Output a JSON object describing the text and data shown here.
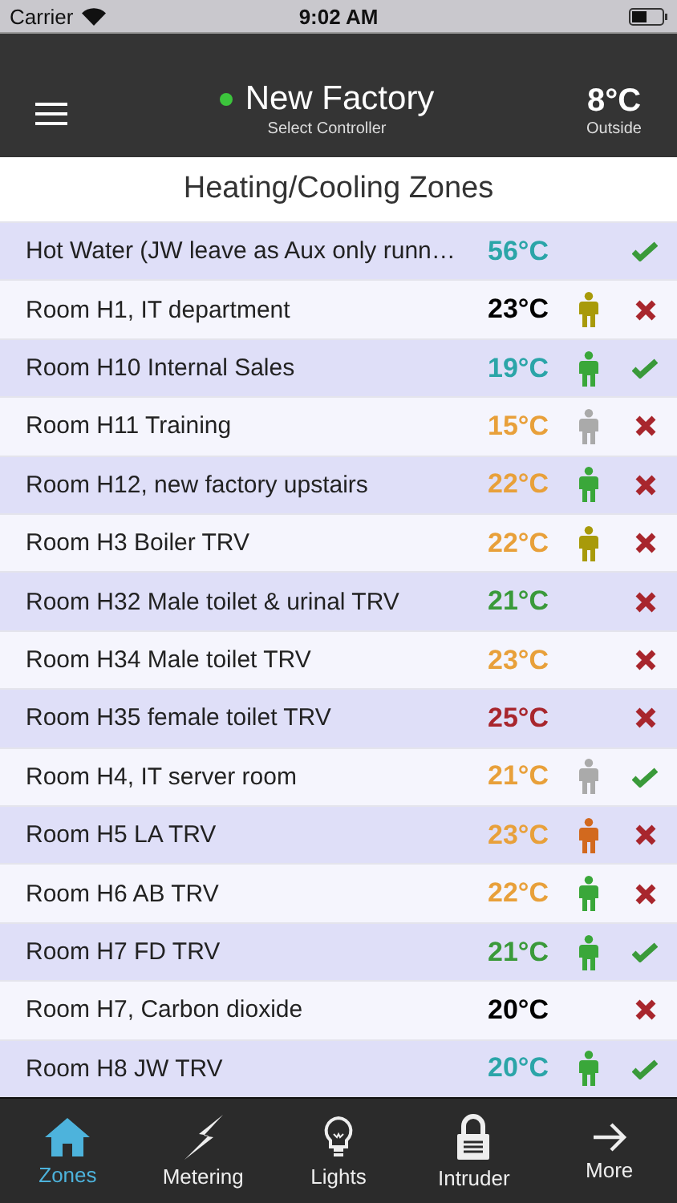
{
  "status_bar": {
    "carrier": "Carrier",
    "time": "9:02 AM"
  },
  "header": {
    "controller": "New Factory",
    "online": true,
    "subtitle": "Select Controller",
    "outside_temp": "8°C",
    "outside_label": "Outside"
  },
  "title": "Heating/Cooling Zones",
  "zones": [
    {
      "name": "Hot Water (JW leave as Aux only runn…",
      "temp": "56°C",
      "color": "#2ba5a8",
      "ok": true
    },
    {
      "name": "Room H1, IT department",
      "temp": "23°C",
      "color": "#000000",
      "person": {
        "color": "#a89a0a"
      },
      "ok": false
    },
    {
      "name": "Room H10 Internal Sales",
      "temp": "19°C",
      "color": "#2ba5a8",
      "person": {
        "color": "#3aa73a"
      },
      "ok": true
    },
    {
      "name": "Room H11 Training",
      "temp": "15°C",
      "color": "#e8a03a",
      "person": {
        "color": "#aaaaaa"
      },
      "ok": false
    },
    {
      "name": "Room H12, new factory upstairs",
      "temp": "22°C",
      "color": "#e8a03a",
      "person": {
        "color": "#3aa73a"
      },
      "ok": false
    },
    {
      "name": "Room H3 Boiler TRV",
      "temp": "22°C",
      "color": "#e8a03a",
      "person": {
        "color": "#a89a0a"
      },
      "ok": false
    },
    {
      "name": "Room H32 Male toilet & urinal TRV",
      "temp": "21°C",
      "color": "#3a9a3a",
      "ok": false
    },
    {
      "name": "Room H34 Male toilet TRV",
      "temp": "23°C",
      "color": "#e8a03a",
      "ok": false
    },
    {
      "name": "Room H35 female toilet TRV",
      "temp": "25°C",
      "color": "#a8262d",
      "ok": false
    },
    {
      "name": "Room H4, IT server room",
      "temp": "21°C",
      "color": "#e8a03a",
      "person": {
        "color": "#aaaaaa"
      },
      "ok": true
    },
    {
      "name": "Room H5 LA TRV",
      "temp": "23°C",
      "color": "#e8a03a",
      "person": {
        "color": "#d2691e"
      },
      "ok": false
    },
    {
      "name": "Room H6 AB TRV",
      "temp": "22°C",
      "color": "#e8a03a",
      "person": {
        "color": "#3aa73a"
      },
      "ok": false
    },
    {
      "name": "Room H7 FD TRV",
      "temp": "21°C",
      "color": "#3a9a3a",
      "person": {
        "color": "#3aa73a"
      },
      "ok": true
    },
    {
      "name": "Room H7, Carbon dioxide",
      "temp": "20°C",
      "color": "#000000",
      "ok": false
    },
    {
      "name": "Room H8 JW TRV",
      "temp": "20°C",
      "color": "#2ba5a8",
      "person": {
        "color": "#3aa73a"
      },
      "ok": true
    }
  ],
  "tabs": [
    {
      "label": "Zones",
      "kind": "home",
      "selected": true
    },
    {
      "label": "Metering",
      "kind": "bolt",
      "selected": false
    },
    {
      "label": "Lights",
      "kind": "bulb",
      "selected": false
    },
    {
      "label": "Intruder",
      "kind": "lock",
      "selected": false
    },
    {
      "label": "More",
      "kind": "arrow",
      "selected": false
    }
  ]
}
